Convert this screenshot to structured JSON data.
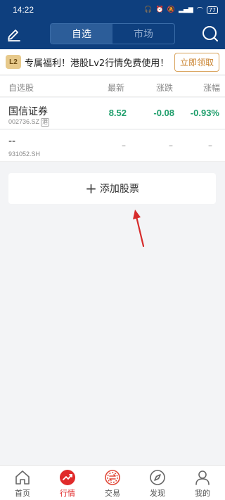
{
  "status": {
    "time": "14:22",
    "battery": "77"
  },
  "header": {
    "tabs": [
      {
        "label": "自选",
        "active": true
      },
      {
        "label": "市场",
        "active": false
      }
    ]
  },
  "promo": {
    "badge": "L2",
    "text": "专属福利！港股Lv2行情免费使用！",
    "button": "立即领取"
  },
  "table": {
    "columns": [
      "自选股",
      "最新",
      "涨跌",
      "涨幅"
    ],
    "rows": [
      {
        "name": "国信证券",
        "code": "002736.SZ",
        "badge": "港",
        "price": "8.52",
        "change": "-0.08",
        "pct": "-0.93%"
      },
      {
        "name": "--",
        "code": "931052.SH",
        "price": "–",
        "change": "–",
        "pct": "–"
      }
    ]
  },
  "add_stock": {
    "plus": "+",
    "label": "添加股票"
  },
  "nav": {
    "items": [
      {
        "label": "首页",
        "icon": "home-icon"
      },
      {
        "label": "行情",
        "icon": "market-icon",
        "active": true
      },
      {
        "label": "交易",
        "icon": "trade-icon"
      },
      {
        "label": "发现",
        "icon": "compass-icon"
      },
      {
        "label": "我的",
        "icon": "profile-icon"
      }
    ]
  },
  "colors": {
    "brand": "#0e3f7e",
    "up": "#e02a2a",
    "down": "#1e9e6b",
    "promo_accent": "#c9822e"
  }
}
